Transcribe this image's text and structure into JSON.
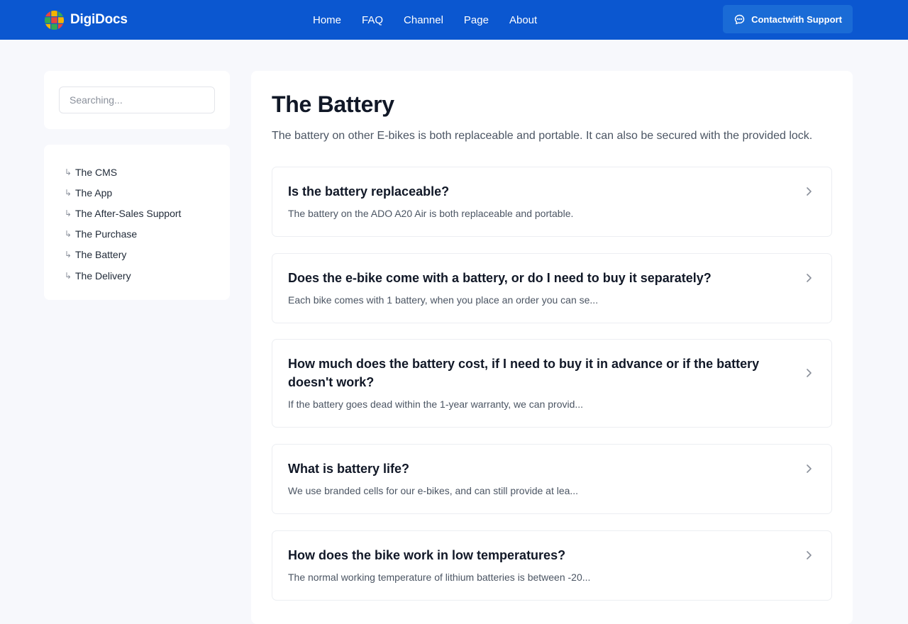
{
  "header": {
    "brand_name": "DigiDocs",
    "logo_icon": "colorful-grid-globe-logo",
    "nav": [
      "Home",
      "FAQ",
      "Channel",
      "Page",
      "About"
    ],
    "support_label": "Contactwith Support",
    "support_icon": "chat-bubble-icon"
  },
  "sidebar": {
    "search_placeholder": "Searching...",
    "categories": [
      "The CMS",
      "The App",
      "The After-Sales Support",
      "The Purchase",
      "The Battery",
      "The Delivery"
    ]
  },
  "main": {
    "title": "The Battery",
    "description": "The battery on other E-bikes is both replaceable and portable. It can also be secured with the provided lock.",
    "faqs": [
      {
        "question": "Is the battery replaceable?",
        "answer": "The battery on the ADO A20 Air is both replaceable and portable."
      },
      {
        "question": "Does the e-bike come with a battery, or do I need to buy it separately?",
        "answer": "Each bike comes with 1 battery, when you place an order you can se..."
      },
      {
        "question": "How much does the battery cost, if I need to buy it in advance or if the battery doesn't work?",
        "answer": "If the battery goes dead within the 1-year warranty, we can provid..."
      },
      {
        "question": "What is battery life?",
        "answer": "We use branded cells for our e-bikes, and can still provide at lea..."
      },
      {
        "question": "How does the bike work in low temperatures?",
        "answer": "The normal working temperature of lithium batteries is between -20..."
      }
    ]
  },
  "colors": {
    "header_bg": "#0b57d0",
    "support_button_bg": "#1a6bd6",
    "page_bg": "#f7f8fc",
    "card_bg": "#ffffff"
  }
}
